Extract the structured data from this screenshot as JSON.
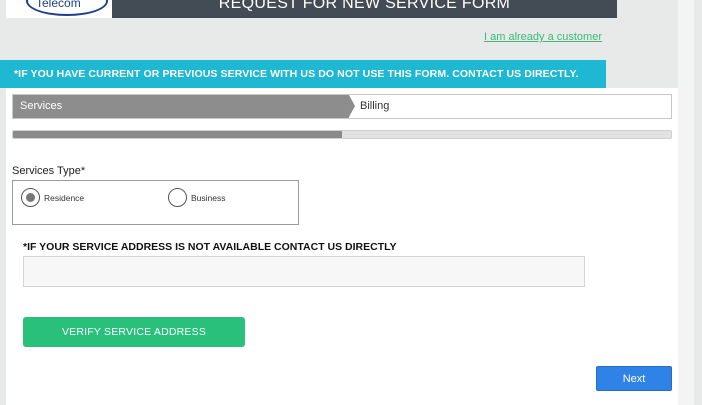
{
  "header": {
    "logo_text": "Telecom",
    "title": "REQUEST FOR NEW SERVICE FORM",
    "title_bar_color": "#434b55"
  },
  "links": {
    "already_customer": "I am already a customer"
  },
  "notice": {
    "text": "*IF YOU HAVE CURRENT OR PREVIOUS SERVICE WITH US DO NOT USE THIS FORM. CONTACT US DIRECTLY.",
    "color": "#1fb8d3"
  },
  "steps": [
    {
      "label": "Services",
      "active": true
    },
    {
      "label": "Billing",
      "active": false
    }
  ],
  "progress": {
    "fraction": 0.5
  },
  "services_type": {
    "label": "Services Type*",
    "options": [
      {
        "label": "Residence",
        "checked": true
      },
      {
        "label": "Business",
        "checked": false
      }
    ]
  },
  "address": {
    "label": "*IF YOUR SERVICE ADDRESS IS NOT AVAILABLE CONTACT US DIRECTLY",
    "value": "",
    "placeholder": ""
  },
  "buttons": {
    "verify": "VERIFY SERVICE ADDRESS",
    "verify_color": "#28c07a",
    "next": "Next",
    "next_color": "#2f82e6"
  }
}
